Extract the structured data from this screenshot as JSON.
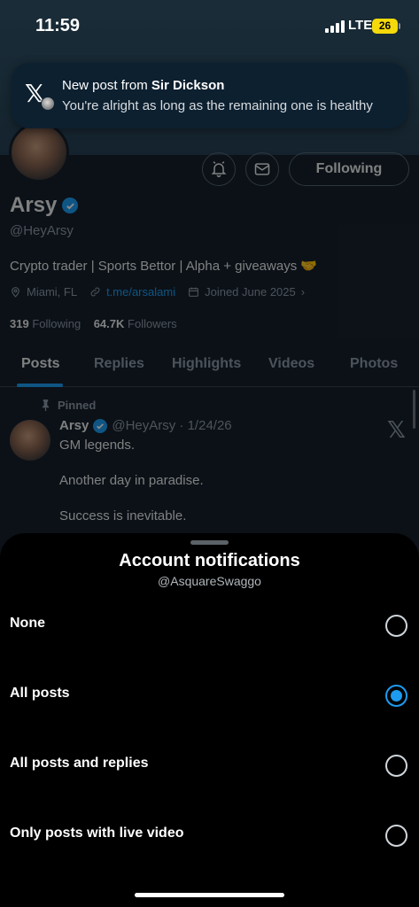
{
  "status_bar": {
    "time": "11:59",
    "network": "LTE",
    "battery": "26"
  },
  "notification": {
    "title_prefix": "New post from ",
    "title_name": "Sir Dickson",
    "body": "You're alright as long as the remaining one is healthy"
  },
  "profile": {
    "following_button": "Following",
    "name": "Arsy",
    "handle": "@HeyArsy",
    "bio": "Crypto trader | Sports Bettor | Alpha + giveaways 🤝",
    "location": "Miami, FL",
    "link": "t.me/arsalami",
    "joined": "Joined June 2025",
    "following_count": "319",
    "following_label": "Following",
    "followers_count": "64.7K",
    "followers_label": "Followers"
  },
  "tabs": [
    {
      "label": "Posts",
      "active": true
    },
    {
      "label": "Replies"
    },
    {
      "label": "Highlights"
    },
    {
      "label": "Videos"
    },
    {
      "label": "Photos"
    }
  ],
  "pinned_post": {
    "pinned_label": "Pinned",
    "name": "Arsy",
    "handle_date": "@HeyArsy · 1/24/26",
    "lines": [
      "GM legends.",
      "Another day in paradise.",
      "Success is inevitable."
    ]
  },
  "sheet": {
    "title": "Account notifications",
    "subtitle": "@AsquareSwaggo",
    "options": [
      {
        "label": "None",
        "selected": false
      },
      {
        "label": "All posts",
        "selected": true
      },
      {
        "label": "All posts and replies",
        "selected": false
      },
      {
        "label": "Only posts with live video",
        "selected": false
      }
    ]
  },
  "colors": {
    "accent": "#1d9bf0",
    "sheet_bg": "#000000",
    "profile_bg": "#15202b"
  }
}
